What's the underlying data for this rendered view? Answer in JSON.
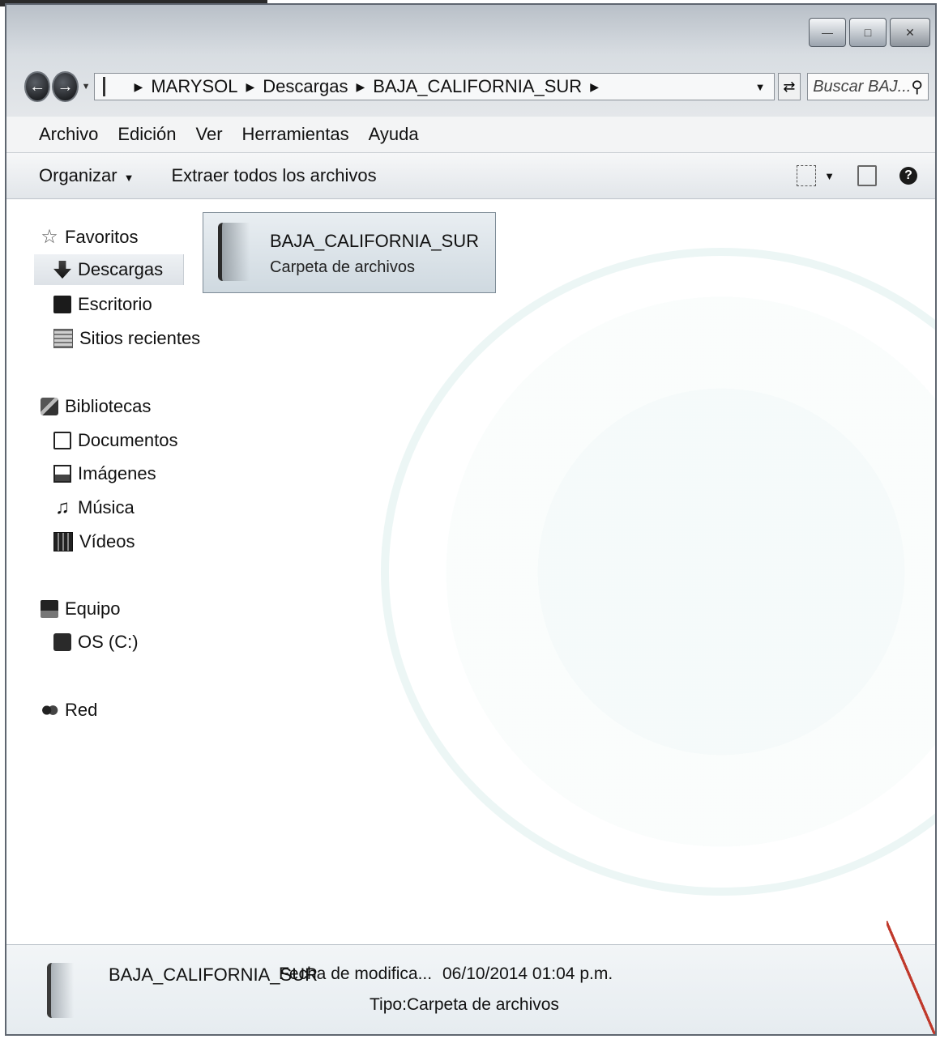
{
  "address_bar": {
    "crumbs": [
      "MARYSOL",
      "Descargas",
      "BAJA_CALIFORNIA_SUR"
    ]
  },
  "search": {
    "placeholder": "Buscar BAJ..."
  },
  "menu": [
    "Archivo",
    "Edición",
    "Ver",
    "Herramientas",
    "Ayuda"
  ],
  "toolbar": {
    "organize_label": "Organizar",
    "extract_label": "Extraer todos los archivos"
  },
  "nav": {
    "favorites": {
      "label": "Favoritos",
      "items": [
        "Descargas",
        "Escritorio",
        "Sitios recientes"
      ]
    },
    "libraries": {
      "label": "Bibliotecas",
      "items": [
        "Documentos",
        "Imágenes",
        "Música",
        "Vídeos"
      ]
    },
    "computer": {
      "label": "Equipo",
      "items": [
        "OS (C:)"
      ]
    },
    "network": {
      "label": "Red"
    }
  },
  "content": {
    "items": [
      {
        "name": "BAJA_CALIFORNIA_SUR",
        "type": "Carpeta de archivos"
      }
    ]
  },
  "details": {
    "name": "BAJA_CALIFORNIA_SUR",
    "modified_label": "Fecha de modifica...",
    "modified_value": "06/10/2014 01:04 p.m.",
    "type_label": "Tipo:",
    "type_value": "Carpeta de archivos"
  },
  "icons": {
    "back": "back-arrow-icon",
    "forward": "forward-arrow-icon",
    "refresh": "refresh-icon",
    "search": "search-icon",
    "help": "help-icon"
  }
}
